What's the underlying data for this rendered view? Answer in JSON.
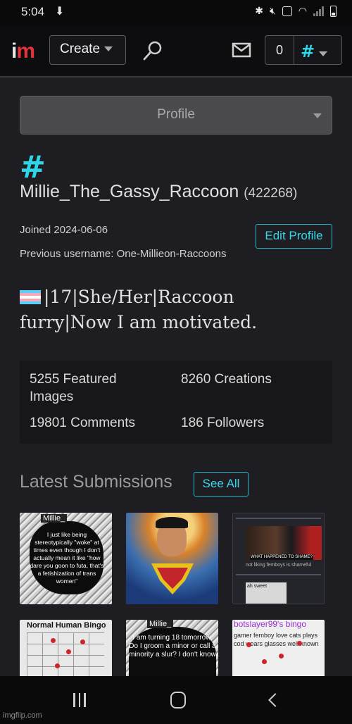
{
  "status_bar": {
    "time": "5:04",
    "download_icon": "download-arrow-icon",
    "icons": [
      "bluetooth-icon",
      "mute-icon",
      "nfc-icon",
      "wifi-icon",
      "signal-icon",
      "battery-icon"
    ]
  },
  "nav": {
    "logo_i": "i",
    "logo_m": "m",
    "create_label": "Create",
    "notification_count": "0",
    "user_icon": "#"
  },
  "profile": {
    "section_select": "Profile",
    "avatar_glyph": "#",
    "username": "Millie_The_Gassy_Raccoon",
    "user_id": "(422268)",
    "joined": "Joined 2024-06-06",
    "previous_username": "Previous username: One-Millieon-Raccoons",
    "edit_label": "Edit Profile",
    "bio_line1": "|17|She/Her|Raccoon",
    "bio_line2": "furry|Now I am motivated."
  },
  "stats": {
    "featured": "5255 Featured Images",
    "creations": "8260 Creations",
    "comments": "19801 Comments",
    "followers": "186 Followers"
  },
  "latest": {
    "heading": "Latest Submissions",
    "see_all": "See All",
    "thumbs": [
      {
        "name": "Millie_",
        "text": "I just like being stereotypically \"woke\" at times even though I don't actually mean it like \"how dare you goon to futa, that's a fetishization of trans women\""
      },
      {
        "name": "",
        "text": ""
      },
      {
        "name": "",
        "caption": "WHAT HAPPENED TO SHAME?",
        "small": "not liking femboys is shameful",
        "card": "ah sweet"
      },
      {
        "name": "Normal Human Bingo",
        "text": ""
      },
      {
        "name": "Millie_",
        "text": "I am turning 18 tomorrow. Do I groom a minor or call a minority a slur? I don't know"
      },
      {
        "name": "botslayer99's bingo",
        "text": "gamer  femboy  love cats  plays cod  wears glasses  well known"
      }
    ]
  },
  "watermark": "imgflip.com"
}
